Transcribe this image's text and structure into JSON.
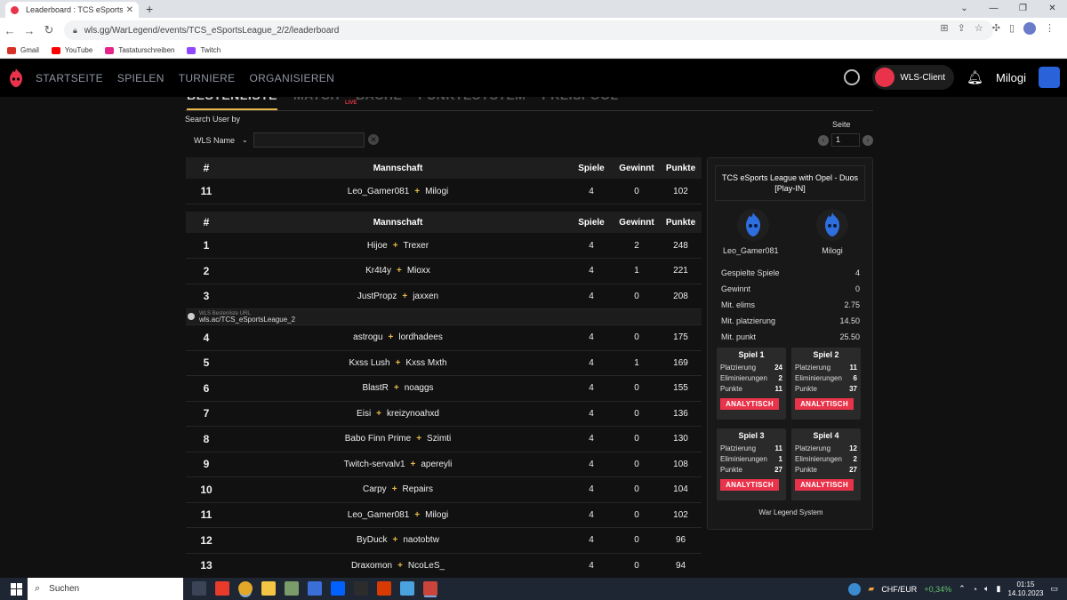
{
  "browser": {
    "tab_title": "Leaderboard : TCS eSports League",
    "new_tab": "+",
    "url": "wls.gg/WarLegend/events/TCS_eSportsLeague_2/2/leaderboard",
    "bookmarks": [
      {
        "label": "Gmail",
        "color": "#d93025"
      },
      {
        "label": "YouTube",
        "color": "#ff0000"
      },
      {
        "label": "Tastaturschreiben",
        "color": "#e8238a"
      },
      {
        "label": "Twitch",
        "color": "#9146ff"
      }
    ]
  },
  "site": {
    "nav": [
      "STARTSEITE",
      "SPIELEN",
      "TURNIERE",
      "ORGANISIEREN"
    ],
    "client_label": "WLS-Client",
    "username": "Milogi",
    "accent": "#e8334a",
    "gold": "#e8b84a"
  },
  "subtabs": [
    "BESTENLISTE",
    "MATCH",
    "BACHE",
    "PUNKTESYSTEM",
    "PREISPOOL"
  ],
  "live_label": "LIVE",
  "search": {
    "label": "Search User by",
    "select_value": "WLS Name",
    "input_value": "",
    "page_label": "Seite",
    "page_value": "1"
  },
  "table": {
    "headers": {
      "rank": "#",
      "team": "Mannschaft",
      "games": "Spiele",
      "wins": "Gewinnt",
      "points": "Punkte"
    },
    "own_row": {
      "rank": "11",
      "p1": "Leo_Gamer081",
      "p2": "Milogi",
      "games": "4",
      "wins": "0",
      "points": "102"
    },
    "rows": [
      {
        "rank": "1",
        "p1": "Hijoe",
        "p2": "Trexer",
        "games": "4",
        "wins": "2",
        "points": "248"
      },
      {
        "rank": "2",
        "p1": "Kr4t4y",
        "p2": "Mioxx",
        "games": "4",
        "wins": "1",
        "points": "221"
      },
      {
        "rank": "3",
        "p1": "JustPropz",
        "p2": "jaxxen",
        "games": "4",
        "wins": "0",
        "points": "208"
      },
      {
        "rank": "4",
        "p1": "astrogu",
        "p2": "lordhadees",
        "games": "4",
        "wins": "0",
        "points": "175"
      },
      {
        "rank": "5",
        "p1": "Kxss Lush",
        "p2": "Kxss Mxth",
        "games": "4",
        "wins": "1",
        "points": "169"
      },
      {
        "rank": "6",
        "p1": "BlastR",
        "p2": "noaggs",
        "games": "4",
        "wins": "0",
        "points": "155"
      },
      {
        "rank": "7",
        "p1": "Eisi",
        "p2": "kreizynoahxd",
        "games": "4",
        "wins": "0",
        "points": "136"
      },
      {
        "rank": "8",
        "p1": "Babo Finn Prime",
        "p2": "Szimti",
        "games": "4",
        "wins": "0",
        "points": "130"
      },
      {
        "rank": "9",
        "p1": "Twitch-servalv1",
        "p2": "apereyli",
        "games": "4",
        "wins": "0",
        "points": "108"
      },
      {
        "rank": "10",
        "p1": "Carpy",
        "p2": "Repairs",
        "games": "4",
        "wins": "0",
        "points": "104"
      },
      {
        "rank": "11",
        "p1": "Leo_Gamer081",
        "p2": "Milogi",
        "games": "4",
        "wins": "0",
        "points": "102"
      },
      {
        "rank": "12",
        "p1": "ByDuck",
        "p2": "naotobtw",
        "games": "4",
        "wins": "0",
        "points": "96"
      },
      {
        "rank": "13",
        "p1": "Draxomon",
        "p2": "NcoLeS_",
        "games": "4",
        "wins": "0",
        "points": "94"
      }
    ],
    "url_banner": {
      "label": "WLS Bestenliste URL",
      "value": "wls.ac/TCS_eSportsLeague_2"
    }
  },
  "side": {
    "title": "TCS eSports League with Opel - Duos [Play-IN]",
    "players": [
      "Leo_Gamer081",
      "Milogi"
    ],
    "stats": [
      {
        "label": "Gespielte Spiele",
        "value": "4"
      },
      {
        "label": "Gewinnt",
        "value": "0"
      },
      {
        "label": "Mit. elims",
        "value": "2.75"
      },
      {
        "label": "Mit. platzierung",
        "value": "14.50"
      },
      {
        "label": "Mit. punkt",
        "value": "25.50"
      }
    ],
    "games": [
      {
        "title": "Spiel 1",
        "placement": "24",
        "elims": "2",
        "points": "11"
      },
      {
        "title": "Spiel 2",
        "placement": "11",
        "elims": "6",
        "points": "37"
      },
      {
        "title": "Spiel 3",
        "placement": "11",
        "elims": "1",
        "points": "27"
      },
      {
        "title": "Spiel 4",
        "placement": "12",
        "elims": "2",
        "points": "27"
      }
    ],
    "labels": {
      "placement": "Platzierung",
      "elims": "Eliminierungen",
      "points": "Punkte",
      "button": "ANALYTISCH"
    },
    "footer": "War Legend System"
  },
  "taskbar": {
    "search_placeholder": "Suchen",
    "currency": "CHF/EUR",
    "currency_change": "+0,34%",
    "time": "01:15",
    "date": "14.10.2023"
  }
}
